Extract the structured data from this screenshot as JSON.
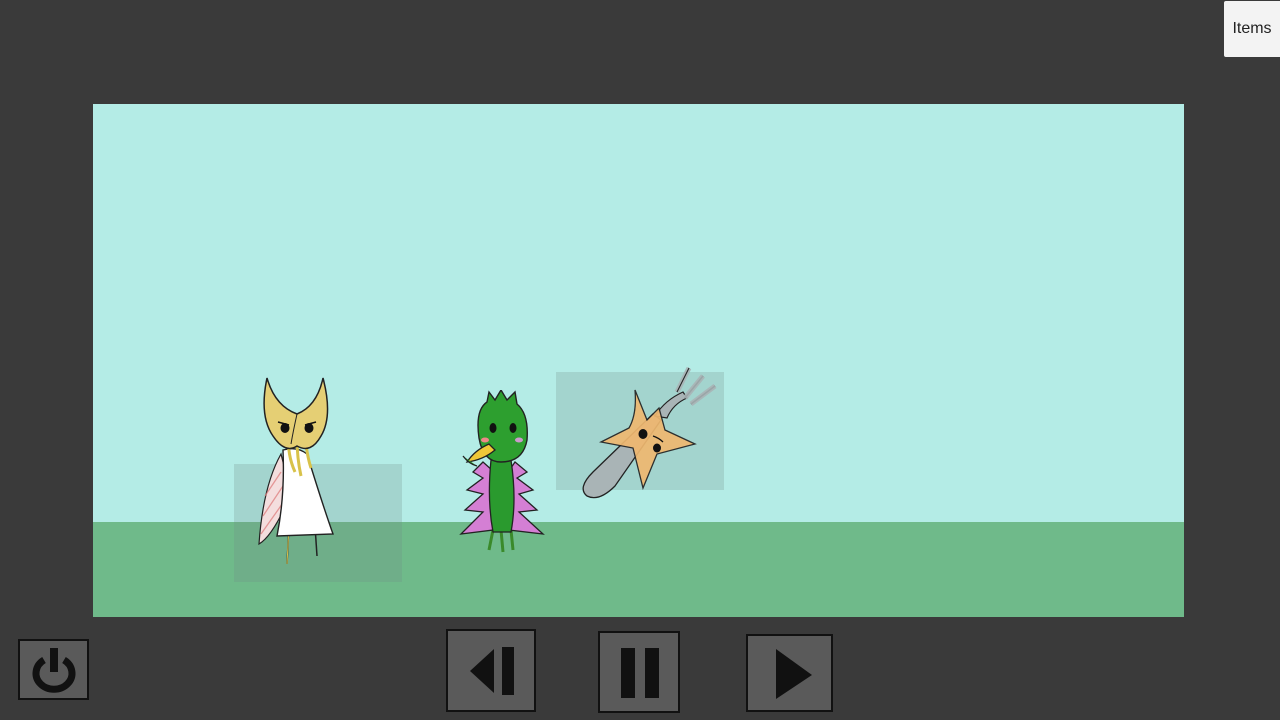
{
  "header": {
    "items_label": "Items"
  },
  "scene": {
    "sky_color": "#b4ece6",
    "ground_color": "#6fba8a",
    "characters": [
      {
        "id": "horned-mask-caped-character",
        "icon": "horned-mask-character-sprite"
      },
      {
        "id": "green-leaf-bird-character",
        "icon": "leaf-bird-character-sprite"
      },
      {
        "id": "fork-star-character",
        "icon": "fork-star-character-sprite"
      }
    ]
  },
  "controls": {
    "power": {
      "icon": "power-icon"
    },
    "step_back": {
      "icon": "step-back-icon"
    },
    "pause": {
      "icon": "pause-icon"
    },
    "play": {
      "icon": "play-icon"
    }
  }
}
